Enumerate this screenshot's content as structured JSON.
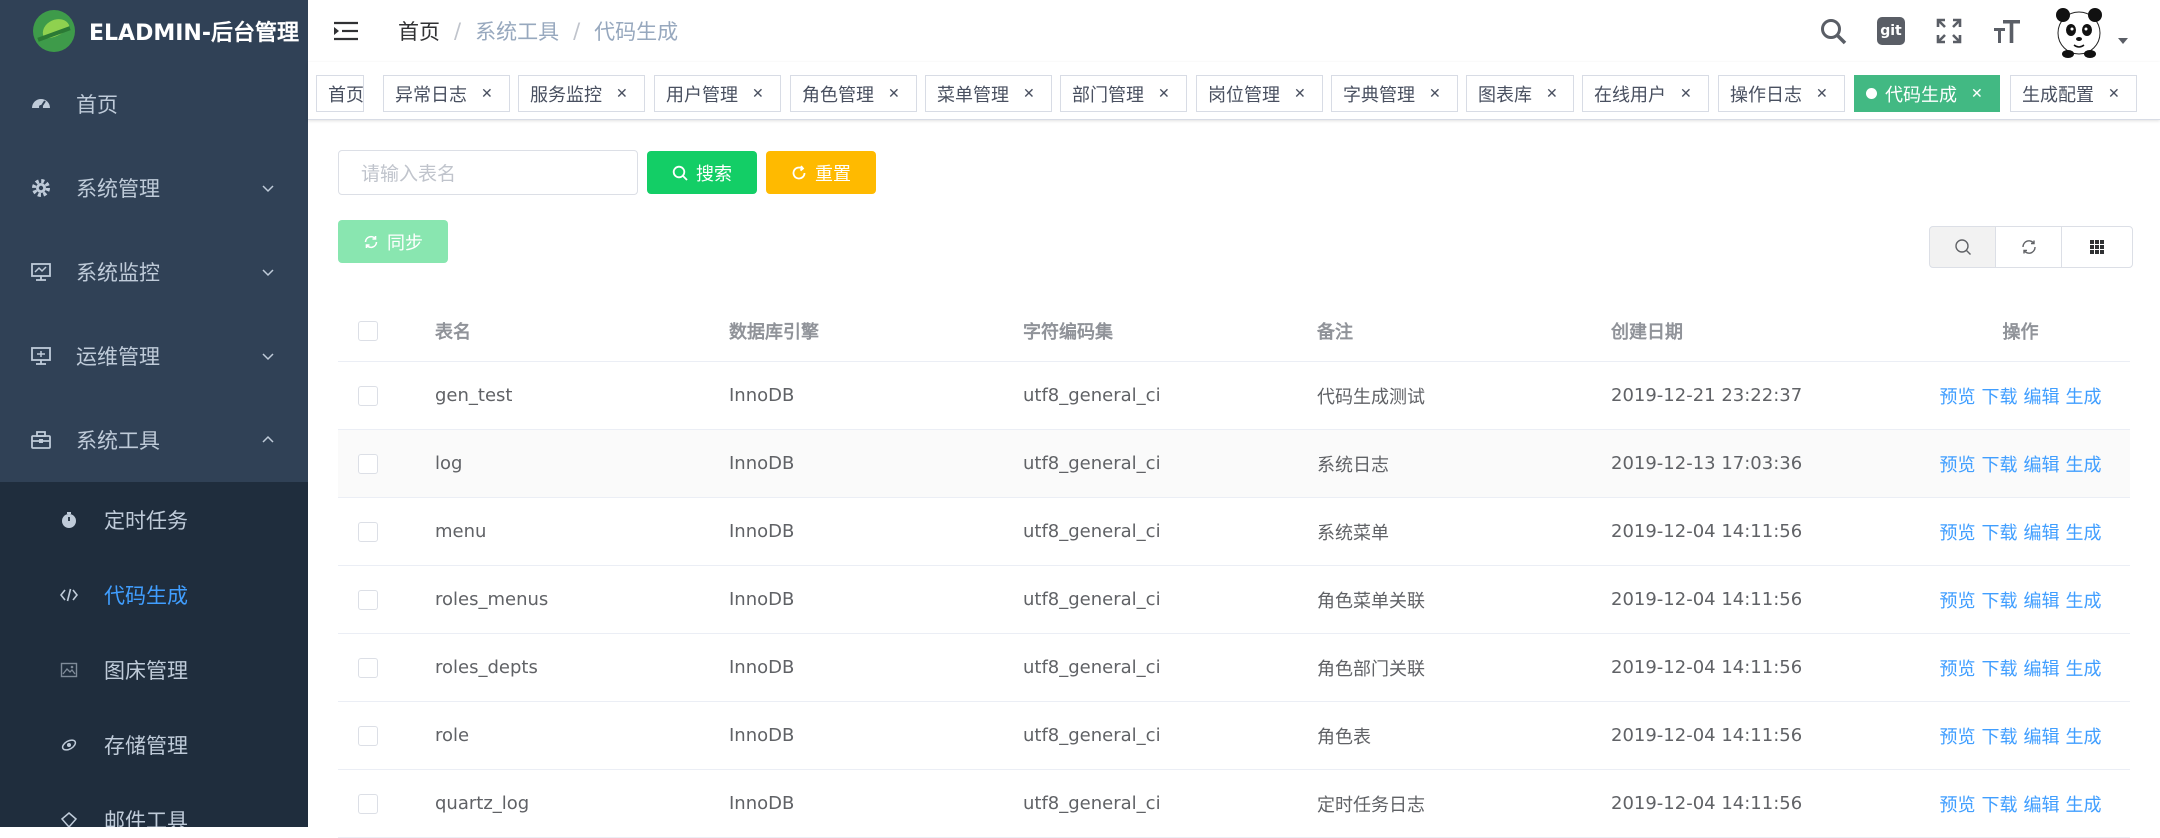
{
  "app": {
    "title": "ELADMIN-后台管理"
  },
  "sidebar": {
    "items": [
      {
        "label": "首页",
        "icon": "dashboard-icon"
      },
      {
        "label": "系统管理",
        "icon": "gear-icon"
      },
      {
        "label": "系统监控",
        "icon": "monitor-icon"
      },
      {
        "label": "运维管理",
        "icon": "ops-monitor-icon"
      },
      {
        "label": "系统工具",
        "icon": "toolbox-icon"
      }
    ],
    "sub_items": [
      {
        "label": "定时任务",
        "icon": "timer-icon"
      },
      {
        "label": "代码生成",
        "icon": "code-icon"
      },
      {
        "label": "图床管理",
        "icon": "image-icon"
      },
      {
        "label": "存储管理",
        "icon": "storage-icon"
      },
      {
        "label": "邮件工具",
        "icon": "email-icon"
      }
    ]
  },
  "navbar": {
    "breadcrumb": [
      "首页",
      "系统工具",
      "代码生成"
    ],
    "separator": "/",
    "git_label": "git"
  },
  "tags": [
    {
      "label": "首页"
    },
    {
      "label": "异常日志"
    },
    {
      "label": "服务监控"
    },
    {
      "label": "用户管理"
    },
    {
      "label": "角色管理"
    },
    {
      "label": "菜单管理"
    },
    {
      "label": "部门管理"
    },
    {
      "label": "岗位管理"
    },
    {
      "label": "字典管理"
    },
    {
      "label": "图表库"
    },
    {
      "label": "在线用户"
    },
    {
      "label": "操作日志"
    },
    {
      "label": "代码生成",
      "active": true
    },
    {
      "label": "生成配置"
    }
  ],
  "toolbar": {
    "search_placeholder": "请输入表名",
    "search_label": "搜索",
    "reset_label": "重置",
    "sync_label": "同步"
  },
  "table": {
    "headers": [
      "表名",
      "数据库引擎",
      "字符编码集",
      "备注",
      "创建日期",
      "操作"
    ],
    "actions": [
      "预览",
      "下载",
      "编辑",
      "生成"
    ],
    "rows": [
      {
        "name": "gen_test",
        "engine": "InnoDB",
        "collation": "utf8_general_ci",
        "remark": "代码生成测试",
        "created": "2019-12-21 23:22:37"
      },
      {
        "name": "log",
        "engine": "InnoDB",
        "collation": "utf8_general_ci",
        "remark": "系统日志",
        "created": "2019-12-13 17:03:36"
      },
      {
        "name": "menu",
        "engine": "InnoDB",
        "collation": "utf8_general_ci",
        "remark": "系统菜单",
        "created": "2019-12-04 14:11:56"
      },
      {
        "name": "roles_menus",
        "engine": "InnoDB",
        "collation": "utf8_general_ci",
        "remark": "角色菜单关联",
        "created": "2019-12-04 14:11:56"
      },
      {
        "name": "roles_depts",
        "engine": "InnoDB",
        "collation": "utf8_general_ci",
        "remark": "角色部门关联",
        "created": "2019-12-04 14:11:56"
      },
      {
        "name": "role",
        "engine": "InnoDB",
        "collation": "utf8_general_ci",
        "remark": "角色表",
        "created": "2019-12-04 14:11:56"
      },
      {
        "name": "quartz_log",
        "engine": "InnoDB",
        "collation": "utf8_general_ci",
        "remark": "定时任务日志",
        "created": "2019-12-04 14:11:56"
      }
    ]
  },
  "colors": {
    "sidebar_bg": "#304156",
    "submenu_bg": "#1f2d3d",
    "accent": "#409eff",
    "success": "#13ce66",
    "warning": "#ffba00",
    "tag_active": "#42b983"
  }
}
